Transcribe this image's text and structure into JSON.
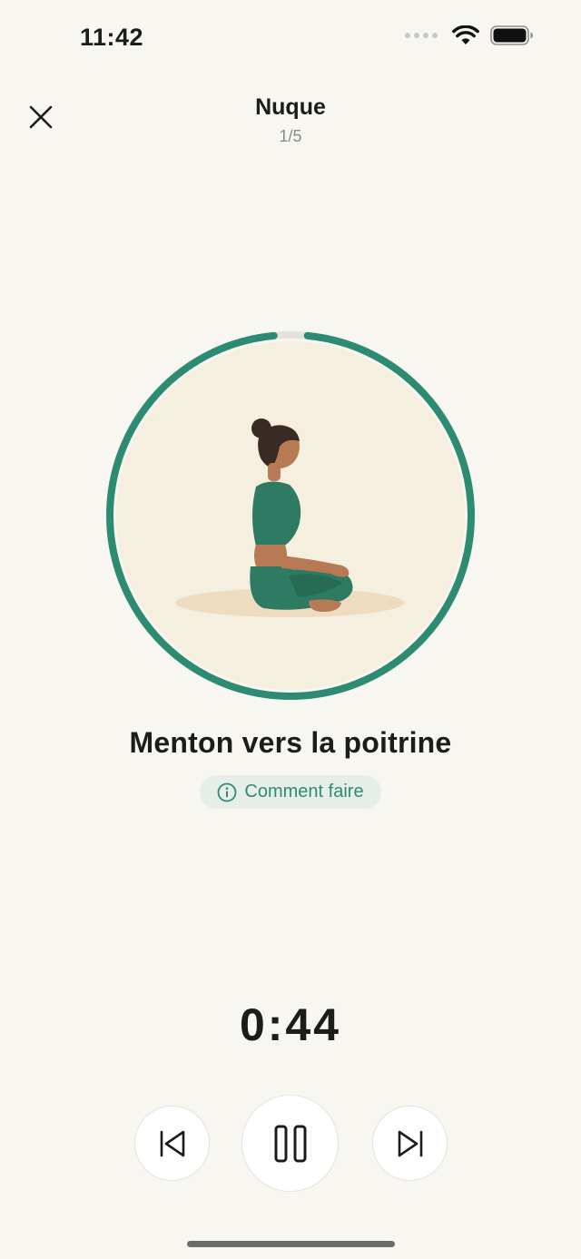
{
  "status_bar": {
    "time": "11:42"
  },
  "header": {
    "title": "Nuque",
    "step": "1/5"
  },
  "exercise": {
    "title": "Menton vers la poitrine",
    "howto_label": "Comment faire",
    "progress_fraction": 0.97
  },
  "timer": {
    "remaining": "0:44"
  },
  "icons": {
    "close": "close-icon",
    "info": "info-icon",
    "previous": "skip-previous-icon",
    "pause": "pause-icon",
    "next": "skip-next-icon"
  },
  "colors": {
    "background": "#f8f6f1",
    "accent": "#2e8b73",
    "ring": "#2e8b73",
    "ring_track": "#e4e2dc",
    "illustration_bg": "#f5efdf",
    "outfit": "#2f7a62",
    "skin": "#b87a55",
    "hair": "#3a2a24"
  }
}
